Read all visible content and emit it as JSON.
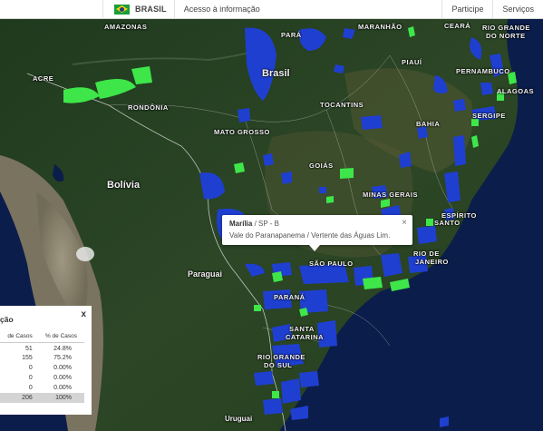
{
  "govbar": {
    "country": "BRASIL",
    "access_info": "Acesso à informação",
    "participate": "Participe",
    "services": "Serviços"
  },
  "map": {
    "countries": {
      "brasil": "Brasil",
      "bolivia": "Bolívia",
      "paraguai": "Paraguai",
      "uruguai": "Uruguai"
    },
    "states": {
      "amazonas": "AMAZONAS",
      "para": "PARÁ",
      "maranhao": "MARANHÃO",
      "ceara": "CEARÁ",
      "rio_grande_do_norte_1": "RIO GRANDE",
      "rio_grande_do_norte_2": "DO NORTE",
      "piaui": "PIAUÍ",
      "pernambuco": "PERNAMBUCO",
      "alagoas": "ALAGOAS",
      "acre": "ACRE",
      "rondonia": "RONDÔNIA",
      "tocantins": "TOCANTINS",
      "bahia": "BAHIA",
      "sergipe": "SERGIPE",
      "mato_grosso": "MATO GROSSO",
      "goias": "GOIÁS",
      "minas_gerais": "MINAS GERAIS",
      "espirito_santo_1": "ESPÍRITO",
      "espirito_santo_2": "SANTO",
      "sao_paulo": "SÃO PAULO",
      "rio_de_janeiro_1": "RIO DE",
      "rio_de_janeiro_2": "JANEIRO",
      "parana": "PARANÁ",
      "santa_catarina_1": "SANTA",
      "santa_catarina_2": "CATARINA",
      "rio_grande_do_sul_1": "RIO GRANDE",
      "rio_grande_do_sul_2": "DO SUL"
    },
    "colors": {
      "category_blue": "#1f3fd1",
      "category_green": "#3ee64a",
      "ocean": "#0b1d4a"
    }
  },
  "popup": {
    "city": "Marília",
    "state_suffix": " / SP - B",
    "region": "Vale do Paranapanema / Vertente das Águas Lim.",
    "close": "×"
  },
  "legend": {
    "title": "ção",
    "close": "x",
    "col_count": "de Casos",
    "col_pct": "% de Casos",
    "rows": [
      {
        "count": "51",
        "pct": "24.8%"
      },
      {
        "count": "155",
        "pct": "75.2%"
      },
      {
        "count": "0",
        "pct": "0.00%"
      },
      {
        "count": "0",
        "pct": "0.00%"
      },
      {
        "count": "0",
        "pct": "0.00%"
      }
    ],
    "total": {
      "count": "206",
      "pct": "100%"
    }
  }
}
